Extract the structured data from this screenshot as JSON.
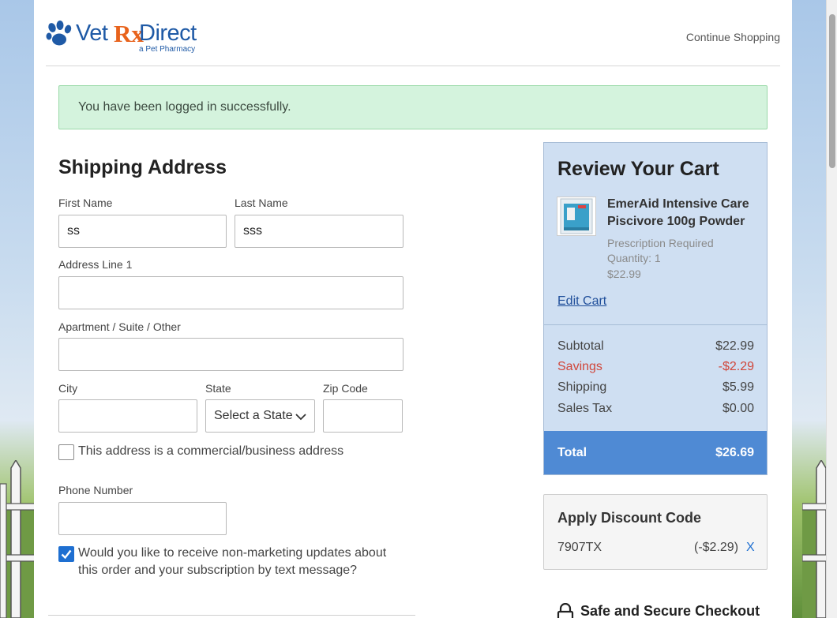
{
  "header": {
    "logo_vet": "Vet",
    "logo_rx": "Rx",
    "logo_direct": "Direct",
    "logo_tagline": "a Pet Pharmacy",
    "continue_shopping": "Continue Shopping"
  },
  "alert": {
    "message": "You have been logged in successfully."
  },
  "shipping": {
    "title": "Shipping Address",
    "first_name_label": "First Name",
    "first_name_value": "ss",
    "last_name_label": "Last Name",
    "last_name_value": "sss",
    "address1_label": "Address Line 1",
    "address1_value": "",
    "apt_label": "Apartment / Suite / Other",
    "apt_value": "",
    "city_label": "City",
    "city_value": "",
    "state_label": "State",
    "state_value": "Select a State",
    "zip_label": "Zip Code",
    "zip_value": "",
    "commercial_label": "This address is a commercial/business address",
    "commercial_checked": false,
    "phone_label": "Phone Number",
    "phone_value": "",
    "sms_label_line1": "Would you like to receive non-marketing updates about",
    "sms_label_line2": "this order and your subscription by text message?",
    "sms_checked": true
  },
  "cart": {
    "title": "Review Your Cart",
    "product_name": "EmerAid Intensive Care Piscivore 100g Powder",
    "prescription": "Prescription Required",
    "quantity": "Quantity: 1",
    "price": "$22.99",
    "edit_cart": "Edit Cart",
    "subtotal_label": "Subtotal",
    "subtotal_value": "$22.99",
    "savings_label": "Savings",
    "savings_value": "-$2.29",
    "shipping_label": "Shipping",
    "shipping_value": "$5.99",
    "tax_label": "Sales Tax",
    "tax_value": "$0.00",
    "total_label": "Total",
    "total_value": "$26.69"
  },
  "discount": {
    "title": "Apply Discount Code",
    "code": "7907TX",
    "amount": "(-$2.29)",
    "remove": "X"
  },
  "secure": {
    "label": "Safe and Secure Checkout"
  },
  "colors": {
    "brand_blue": "#1f5aa6",
    "brand_orange": "#e8631c",
    "alert_green": "#d4f3dd",
    "cart_bg": "#cfdff2",
    "total_bg": "#4f8ad4",
    "savings_red": "#d0463a",
    "checkbox_blue": "#1e6fd1"
  }
}
